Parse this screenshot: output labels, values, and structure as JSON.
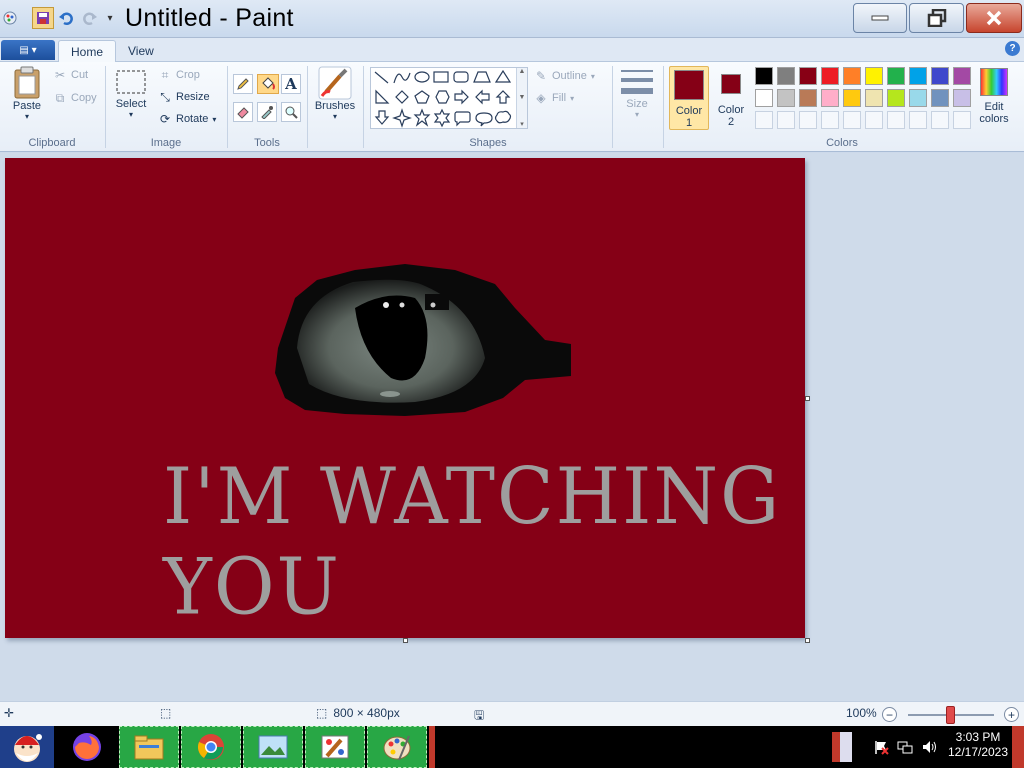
{
  "window": {
    "title": "Untitled - Paint"
  },
  "tabs": {
    "file": "▤ ▾",
    "home": "Home",
    "view": "View"
  },
  "clipboard": {
    "paste": "Paste",
    "cut": "Cut",
    "copy": "Copy",
    "group": "Clipboard"
  },
  "image": {
    "select": "Select",
    "crop": "Crop",
    "resize": "Resize",
    "rotate": "Rotate",
    "group": "Image"
  },
  "tools": {
    "group": "Tools",
    "text_glyph": "A"
  },
  "brushes": {
    "label": "Brushes"
  },
  "shapes": {
    "group": "Shapes",
    "outline": "Outline",
    "fill": "Fill"
  },
  "size": {
    "label": "Size"
  },
  "colors": {
    "color1_label": "Color",
    "color1_num": "1",
    "color2_label": "Color",
    "color2_num": "2",
    "edit": "Edit colors",
    "group": "Colors",
    "color1": "#850016",
    "color2": "#850016",
    "palette_row1": [
      "#000000",
      "#7f7f7f",
      "#880015",
      "#ed1c24",
      "#ff7f27",
      "#fff200",
      "#22b14c",
      "#00a2e8",
      "#3f48cc",
      "#a349a4"
    ],
    "palette_row2": [
      "#ffffff",
      "#c3c3c3",
      "#b97a57",
      "#ffaec9",
      "#ffc90e",
      "#efe4b0",
      "#b5e61d",
      "#99d9ea",
      "#7092be",
      "#c8bfe7"
    ]
  },
  "canvas": {
    "text": "I'M WATCHING YOU",
    "background": "#850016"
  },
  "status": {
    "size": "800 × 480px",
    "zoom": "100%"
  },
  "clock": {
    "time": "3:03 PM",
    "date": "12/17/2023"
  }
}
